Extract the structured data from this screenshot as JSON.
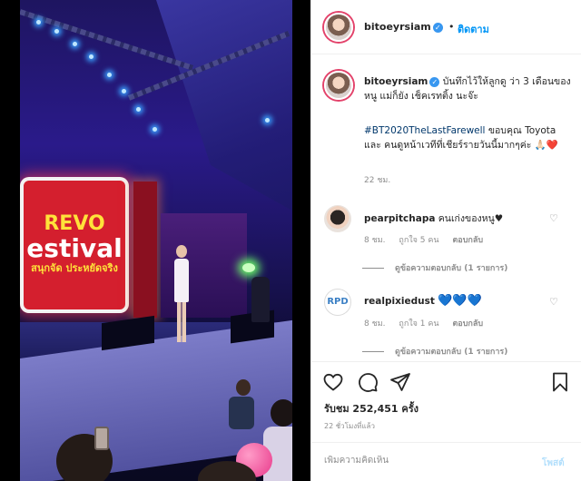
{
  "post": {
    "username": "bitoeyrsiam",
    "follow_separator": "•",
    "follow_label": "ติดตาม",
    "caption_text": "บันทึกไว้ให้ลูกดู ว่า 3 เดือนของหนู แม่ก็ยัง เช็คเรทติ้ง นะจ๊ะ",
    "caption_hashtag": "#BT2020TheLastFarewell",
    "caption_rest": " ขอบคุณ Toyota และ คนดูหน้าเวทีที่เชียร์รายวันนี้มากๆค่ะ 🙏🏻❤️",
    "caption_time": "22 ชม.",
    "likes_label": "รับชม 252,451 ครั้ง",
    "posted_ago": "22 ชั่วโมงที่แล้ว"
  },
  "video": {
    "sign_line1": "REVO",
    "sign_line2": "estival",
    "sign_line3": "สนุกจัด ประหยัดจริง"
  },
  "comments": [
    {
      "username": "pearpitchapa",
      "text": "คนเก่งของหนู♥",
      "time": "8 ชม.",
      "likes": "ถูกใจ 5 คน",
      "reply_label": "ตอบกลับ",
      "view_replies": "ดูข้อความตอบกลับ (1 รายการ)"
    },
    {
      "username": "realpixiedust",
      "avatar_text": "RPD",
      "text": "💙💙💙",
      "time": "8 ชม.",
      "likes": "ถูกใจ 1 คน",
      "reply_label": "ตอบกลับ",
      "view_replies": "ดูข้อความตอบกลับ (1 รายการ)"
    }
  ],
  "add_comment": {
    "placeholder": "เพิ่มความคิดเห็น",
    "post_label": "โพสต์"
  },
  "icons": {
    "like": "heart-icon",
    "comment": "comment-icon",
    "share": "paper-plane-icon",
    "save": "bookmark-icon",
    "verified": "verified-badge-icon",
    "comment_like": "small-heart-icon"
  },
  "colors": {
    "link_blue": "#0095f6",
    "verified_blue": "#3897f0",
    "text": "#262626",
    "muted": "#8e8e8e",
    "post_disabled": "#b2dffc"
  }
}
